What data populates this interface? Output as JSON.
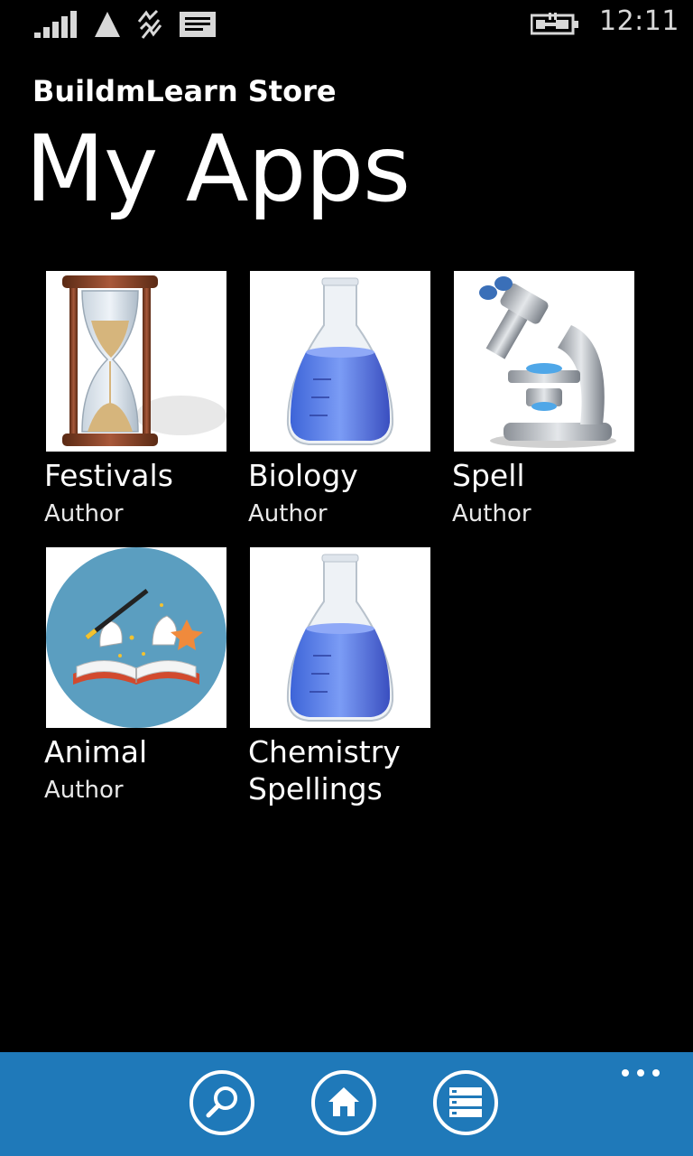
{
  "status_bar": {
    "time": "12:11",
    "icons": [
      "signal-strength-icon",
      "network-triangle-icon",
      "data-activity-icon",
      "message-icon",
      "battery-charging-icon"
    ]
  },
  "app": {
    "title": "BuildmLearn Store",
    "page_title": "My Apps"
  },
  "apps": [
    {
      "name": "Festivals",
      "subtitle": "Author",
      "icon": "hourglass-icon"
    },
    {
      "name": "Biology",
      "subtitle": "Author",
      "icon": "flask-icon"
    },
    {
      "name": "Spell",
      "subtitle": "Author",
      "icon": "microscope-icon"
    },
    {
      "name": "Animal",
      "subtitle": "Author",
      "icon": "magic-book-icon"
    },
    {
      "name": "Chemistry",
      "subtitle": "Spellings",
      "icon": "flask-icon"
    }
  ],
  "app_bar": {
    "buttons": [
      "search-icon",
      "home-icon",
      "list-icon"
    ],
    "more": "ellipsis-icon"
  },
  "colors": {
    "background": "#000000",
    "app_bar": "#1f79b9",
    "text": "#ffffff"
  }
}
